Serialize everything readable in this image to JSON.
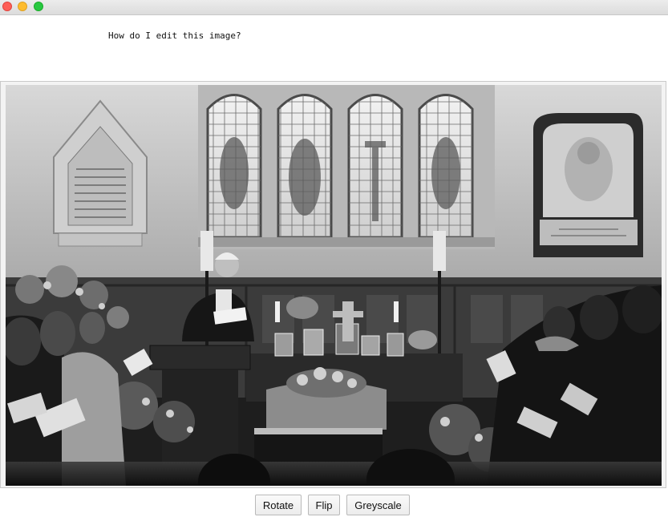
{
  "window": {
    "controls": [
      "close-button",
      "minimize-button",
      "zoom-button"
    ]
  },
  "prompt": {
    "text": "How do I edit this image?"
  },
  "image": {
    "content": "black-and-white photograph of a church interior with stained glass windows, a speaker at a lectern, a flower-covered coffin and seated mourners"
  },
  "toolbar": {
    "rotate_label": "Rotate",
    "flip_label": "Flip",
    "greyscale_label": "Greyscale"
  },
  "colors": {
    "close": "#fe5f57",
    "minimize": "#febc2e",
    "zoom": "#28c840"
  }
}
